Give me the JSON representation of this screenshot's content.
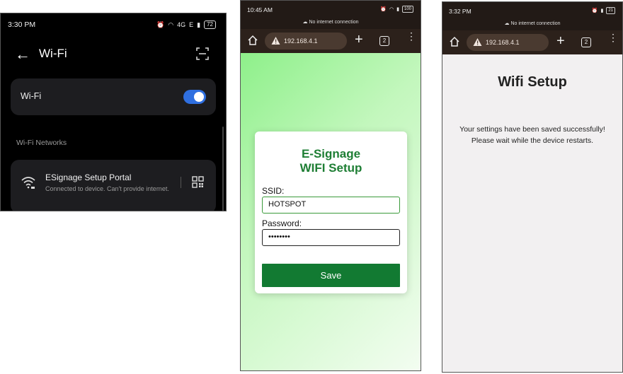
{
  "panel1": {
    "status_time": "3:30 PM",
    "status_network": "4G",
    "status_network2": "E",
    "battery": "72",
    "title": "Wi-Fi",
    "wifi_label": "Wi-Fi",
    "wifi_enabled": true,
    "section_title": "Wi-Fi Networks",
    "network": {
      "name": "ESignage Setup Portal",
      "status": "Connected to device. Can't provide internet."
    },
    "icons": [
      "back-arrow-icon",
      "scan-icon",
      "wifi-icon",
      "qr-code-icon"
    ],
    "accent": "#2f6fe0"
  },
  "panel2": {
    "status_time": "10:45 AM",
    "battery": "100",
    "no_internet": "No internet connection",
    "url": "192.168.4.1",
    "tab_count": "2",
    "form": {
      "title_line1": "E-Signage",
      "title_line2": "WIFI Setup",
      "ssid_label": "SSID:",
      "ssid_value": "HOTSPOT",
      "password_label": "Password:",
      "password_value": "••••••••",
      "save_label": "Save"
    },
    "colors": {
      "title": "#1e7e34",
      "button": "#127a32"
    }
  },
  "panel3": {
    "status_time": "3:32 PM",
    "battery": "21",
    "no_internet": "No internet connection",
    "url": "192.168.4.1",
    "tab_count": "2",
    "heading": "Wifi Setup",
    "message_line1": "Your settings have been saved successfully!",
    "message_line2": "Please wait while the device restarts."
  }
}
